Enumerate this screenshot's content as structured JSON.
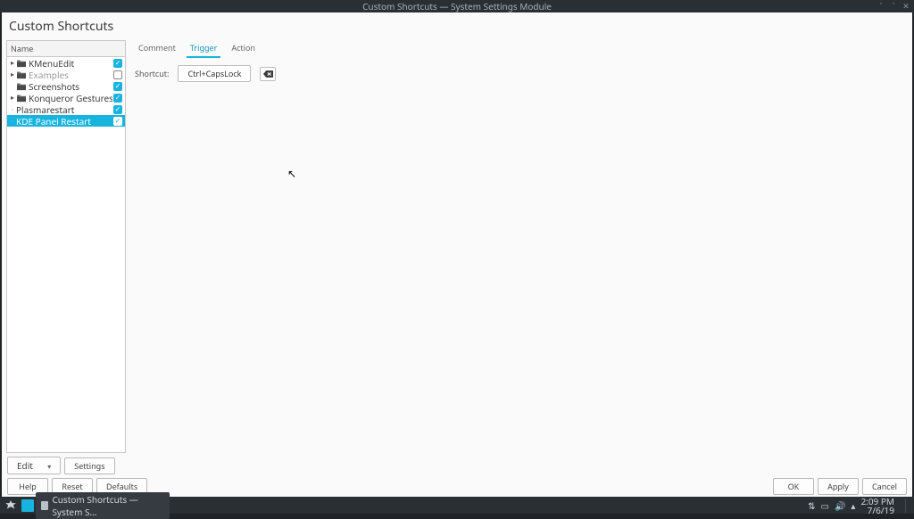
{
  "window_title": "Custom Shortcuts — System Settings Module",
  "page_title": "Custom Shortcuts",
  "tree": {
    "header": "Name",
    "items": [
      {
        "label": "KMenuEdit",
        "folder": true,
        "expandable": true,
        "checked": true,
        "disabled": false
      },
      {
        "label": "Examples",
        "folder": true,
        "expandable": true,
        "checked": false,
        "disabled": true
      },
      {
        "label": "Screenshots",
        "folder": true,
        "expandable": false,
        "checked": true,
        "disabled": false
      },
      {
        "label": "Konqueror Gestures",
        "folder": true,
        "expandable": true,
        "checked": true,
        "disabled": false
      },
      {
        "label": "Plasmarestart",
        "folder": false,
        "expandable": false,
        "checked": true,
        "disabled": false
      },
      {
        "label": "KDE Panel Restart",
        "folder": false,
        "expandable": false,
        "checked": true,
        "disabled": false,
        "selected": true
      }
    ]
  },
  "tabs": [
    {
      "label": "Comment",
      "active": false
    },
    {
      "label": "Trigger",
      "active": true
    },
    {
      "label": "Action",
      "active": false
    }
  ],
  "trigger": {
    "label": "Shortcut:",
    "value": "Ctrl+CapsLock"
  },
  "edit_buttons": {
    "edit": "Edit",
    "settings": "Settings"
  },
  "action_buttons": {
    "help": "Help",
    "reset": "Reset",
    "defaults": "Defaults",
    "ok": "OK",
    "apply": "Apply",
    "cancel": "Cancel"
  },
  "taskbar": {
    "task_label": "Custom Shortcuts — System S…",
    "time": "2:09 PM",
    "date": "7/6/19"
  }
}
